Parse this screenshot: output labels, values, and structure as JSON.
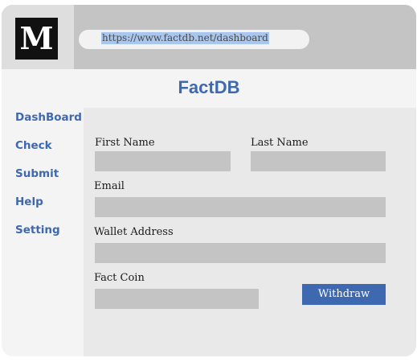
{
  "browser": {
    "logo_letter": "M",
    "url": "https://www.factdb.net/dashboard"
  },
  "app": {
    "title": "FactDB"
  },
  "sidebar": {
    "items": [
      {
        "label": "DashBoard"
      },
      {
        "label": "Check"
      },
      {
        "label": "Submit"
      },
      {
        "label": "Help"
      },
      {
        "label": "Setting"
      }
    ]
  },
  "form": {
    "first_name_label": "First Name",
    "first_name_value": "",
    "last_name_label": "Last Name",
    "last_name_value": "",
    "email_label": "Email",
    "email_value": "",
    "wallet_label": "Wallet Address",
    "wallet_value": "",
    "fact_coin_label": "Fact Coin",
    "fact_coin_value": "",
    "withdraw_label": "Withdraw"
  },
  "colors": {
    "accent": "#3e68b0",
    "titlebar": "#c4c4c4",
    "field": "#c4c4c4",
    "url_highlight": "#a9c6ee"
  }
}
